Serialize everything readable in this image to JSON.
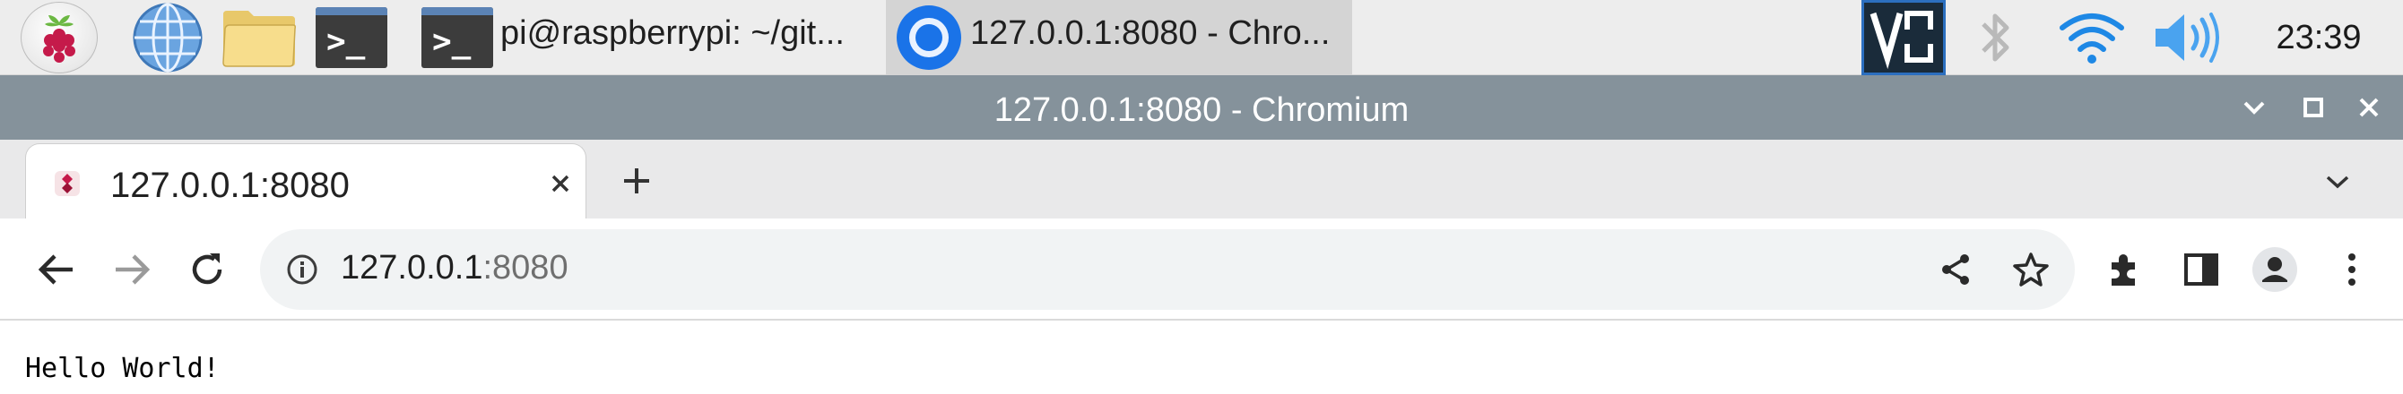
{
  "taskbar": {
    "menu_icon": "raspberry-icon",
    "terminal_task_label": "pi@raspberrypi: ~/git...",
    "chrome_task_label": "127.0.0.1:8080 - Chro...",
    "clock": "23:39",
    "terminal_glyph": ">_",
    "vnc_glyph": "V2"
  },
  "window": {
    "title": "127.0.0.1:8080 - Chromium"
  },
  "tabs": {
    "active_tab_title": "127.0.0.1:8080"
  },
  "omnibox": {
    "host": "127.0.0.1",
    "port": ":8080"
  },
  "page": {
    "body_text": "Hello World!"
  },
  "colors": {
    "taskbar_bg": "#ededed",
    "titlebar_bg": "#85929b",
    "tabstrip_bg": "#e9e9ea",
    "omnibox_bg": "#f1f3f4",
    "chrome_blue": "#1a73e8",
    "wifi_blue": "#1e88e5"
  }
}
